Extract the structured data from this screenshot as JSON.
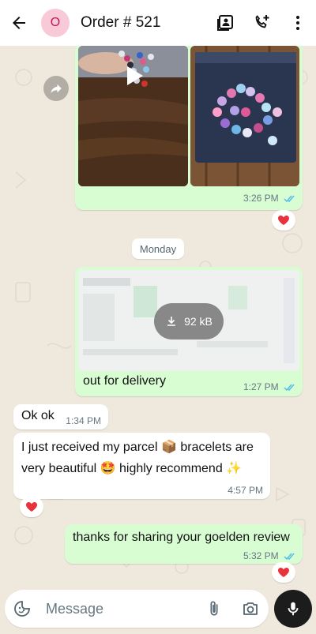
{
  "header": {
    "avatar_letter": "O",
    "title": "Order # 521",
    "icons": [
      "back-arrow-icon",
      "contact-card-icon",
      "add-call-icon",
      "more-vert-icon"
    ]
  },
  "messages": {
    "photos": {
      "time": "3:26 PM",
      "reaction": "heart"
    },
    "day_divider": "Monday",
    "document": {
      "size": "92 kB",
      "caption": "out for delivery",
      "time": "1:27 PM"
    },
    "ok": {
      "text": "Ok ok",
      "time": "1:34 PM"
    },
    "received": {
      "line1_a": "I just received my parcel",
      "line1_emoji": "📦",
      "line1_b": "bracelets are",
      "line2_a": "very beautiful",
      "line2_emoji": "🤩",
      "line2_b": "highly recommend",
      "line2_emoji2": "✨",
      "time": "4:57 PM",
      "reaction": "heart"
    },
    "thanks": {
      "text": "thanks for sharing your goelden review",
      "time": "5:32 PM",
      "reaction": "heart"
    }
  },
  "composer": {
    "placeholder": "Message"
  },
  "colors": {
    "outgoing": "#d9fdd3",
    "incoming": "#ffffff",
    "ticks": "#53bdeb",
    "heart": "#e8323c"
  }
}
